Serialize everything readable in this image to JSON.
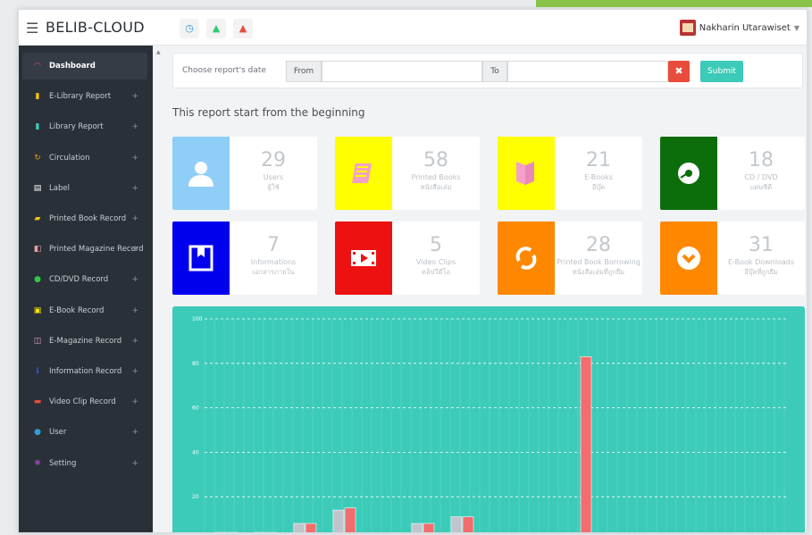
{
  "topbar": {
    "brand": "BELIB-CLOUD",
    "user_name": "Nakharin Utarawiset",
    "icons": [
      "clock-icon",
      "bell-green-icon",
      "bell-red-icon"
    ]
  },
  "sidebar": {
    "items": [
      {
        "label": "Dashboard",
        "icon": "dashboard-icon",
        "color": "#e84393",
        "glyph": "◠",
        "plus": ""
      },
      {
        "label": "E-Library Report",
        "icon": "bar-chart-icon",
        "color": "#f1c40f",
        "glyph": "▮",
        "plus": "+"
      },
      {
        "label": "Library Report",
        "icon": "bar-chart-icon",
        "color": "#3ccbb9",
        "glyph": "▮",
        "plus": "+"
      },
      {
        "label": "Circulation",
        "icon": "refresh-icon",
        "color": "#f39c12",
        "glyph": "↻",
        "plus": "+"
      },
      {
        "label": "Label",
        "icon": "print-icon",
        "color": "#ffffff",
        "glyph": "▤",
        "plus": "+"
      },
      {
        "label": "Printed Book Record",
        "icon": "book-icon",
        "color": "#f1c40f",
        "glyph": "▰",
        "plus": "+"
      },
      {
        "label": "Printed Magazine Record",
        "icon": "magazine-icon",
        "color": "#e8a0a0",
        "glyph": "◧",
        "plus": "+"
      },
      {
        "label": "CD/DVD Record",
        "icon": "disc-icon",
        "color": "#2ecc40",
        "glyph": "●",
        "plus": "+"
      },
      {
        "label": "E-Book Record",
        "icon": "ebook-icon",
        "color": "#f1e40f",
        "glyph": "▣",
        "plus": "+"
      },
      {
        "label": "E-Magazine Record",
        "icon": "emagazine-icon",
        "color": "#e8a0c0",
        "glyph": "◫",
        "plus": "+"
      },
      {
        "label": "Information Record",
        "icon": "info-icon",
        "color": "#2f5fff",
        "glyph": "ℹ",
        "plus": "+"
      },
      {
        "label": "Video Clip Record",
        "icon": "video-icon",
        "color": "#e74c3c",
        "glyph": "▬",
        "plus": "+"
      },
      {
        "label": "User",
        "icon": "user-icon",
        "color": "#3498db",
        "glyph": "●",
        "plus": "+"
      },
      {
        "label": "Setting",
        "icon": "gear-icon",
        "color": "#8e44ad",
        "glyph": "✱",
        "plus": "+"
      }
    ]
  },
  "filter": {
    "label": "Choose report's date",
    "from_label": "From",
    "to_label": "To",
    "from_value": "",
    "to_value": "",
    "submit_label": "Submit"
  },
  "note": "This report start from the beginning",
  "tiles": [
    {
      "value": "29",
      "label": "Users",
      "thai": "ผู้ใช้",
      "icon": "user-icon",
      "color": "#8fcef7"
    },
    {
      "value": "58",
      "label": "Printed Books",
      "thai": "หนังสือเล่ม",
      "icon": "book-icon",
      "color": "#ffff00"
    },
    {
      "value": "21",
      "label": "E-Books",
      "thai": "อีบุ๊ค",
      "icon": "ebook-icon",
      "color": "#ffff00"
    },
    {
      "value": "18",
      "label": "CD / DVD",
      "thai": "แผ่นซีดี",
      "icon": "disc-icon",
      "color": "#0b6e0b"
    },
    {
      "value": "7",
      "label": "Informations",
      "thai": "เอกสารภายใน",
      "icon": "bookmark-icon",
      "color": "#0000ee"
    },
    {
      "value": "5",
      "label": "Video Clips",
      "thai": "คลิปวีดีโอ",
      "icon": "film-icon",
      "color": "#ee1111"
    },
    {
      "value": "28",
      "label": "Printed Book Borrowing",
      "thai": "หนังสือเล่มที่ถูกยืม",
      "icon": "refresh-icon",
      "color": "#ff8800"
    },
    {
      "value": "31",
      "label": "E-Book Downloads",
      "thai": "อีบุ๊คที่ถูกยืม",
      "icon": "download-icon",
      "color": "#ff8800"
    }
  ],
  "colors": {
    "accent": "#3ccbb9",
    "bar_gray": "#c0c4cc",
    "bar_red": "#f26d6d"
  },
  "chart_data": {
    "type": "bar",
    "y_ticks": [
      "100",
      "80",
      "60",
      "40",
      "20"
    ],
    "ylim": [
      0,
      100
    ],
    "series": [
      {
        "values": [
          4,
          4,
          8,
          14,
          3,
          8,
          11,
          1,
          0,
          2
        ]
      },
      {
        "values": [
          4,
          4,
          8,
          15,
          3,
          8,
          11,
          1,
          0,
          83
        ]
      }
    ]
  }
}
